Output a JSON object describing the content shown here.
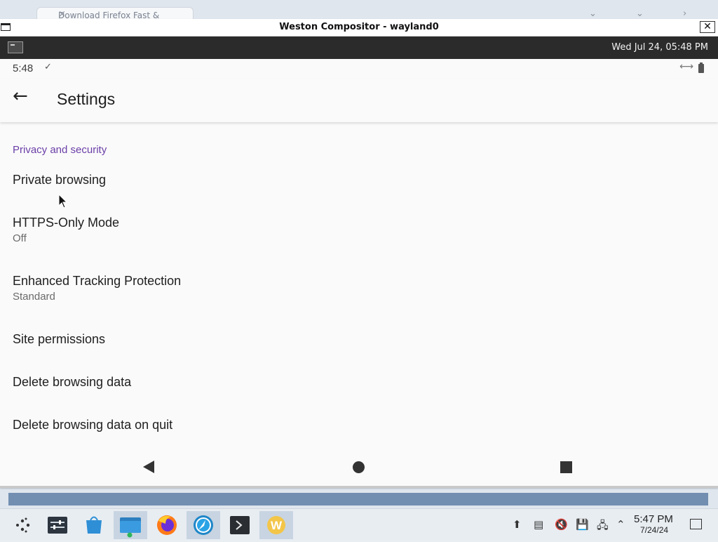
{
  "host": {
    "tab_title": "Download Firefox Fast &",
    "tab_close": "×"
  },
  "window": {
    "title": "Weston Compositor - wayland0",
    "close_glyph": "✕"
  },
  "panel": {
    "clock": "Wed Jul 24, 05:48 PM"
  },
  "android_status": {
    "time": "5:48",
    "download_glyph": "✓",
    "signal_glyph": "⟷"
  },
  "appbar": {
    "back_glyph": "←",
    "title": "Settings"
  },
  "section": {
    "header": "Privacy and security"
  },
  "items": [
    {
      "label": "Private browsing",
      "value": ""
    },
    {
      "label": "HTTPS-Only Mode",
      "value": "Off"
    },
    {
      "label": "Enhanced Tracking Protection",
      "value": "Standard"
    },
    {
      "label": "Site permissions",
      "value": ""
    },
    {
      "label": "Delete browsing data",
      "value": ""
    },
    {
      "label": "Delete browsing data on quit",
      "value": ""
    }
  ],
  "taskbar": {
    "time": "5:47 PM",
    "date": "7/24/24",
    "apps": [
      "app-launcher-icon",
      "settings-panel-icon",
      "store-icon",
      "file-manager-icon",
      "firefox-icon",
      "browser-icon",
      "terminal-icon",
      "w-app-icon"
    ],
    "tray": [
      "update-icon",
      "clipboard-icon",
      "mute-icon",
      "storage-icon",
      "network-icon",
      "chevron-up-icon"
    ]
  },
  "colors": {
    "accent": "#6b3fa8",
    "panel": "#2b2b2b"
  }
}
